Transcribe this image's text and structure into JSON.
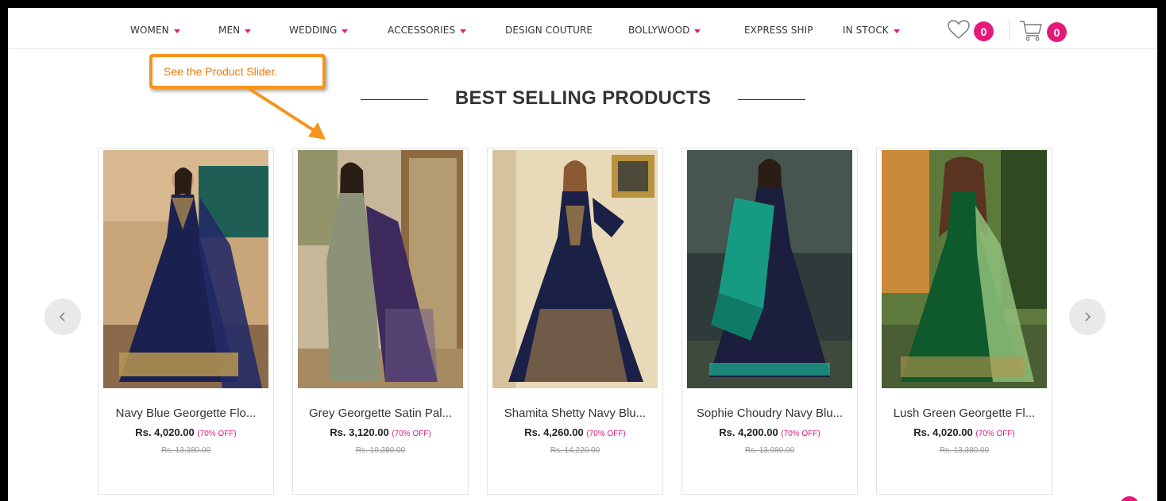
{
  "nav": {
    "items": [
      {
        "label": "WOMEN",
        "caret": true
      },
      {
        "label": "MEN",
        "caret": true
      },
      {
        "label": "WEDDING",
        "caret": true
      },
      {
        "label": "ACCESSORIES",
        "caret": true
      },
      {
        "label": "DESIGN COUTURE",
        "caret": false
      },
      {
        "label": "BOLLYWOOD",
        "caret": true
      },
      {
        "label": "EXPRESS SHIP",
        "caret": false
      },
      {
        "label": "IN STOCK",
        "caret": true
      }
    ],
    "wishlist_count": "0",
    "cart_count": "0"
  },
  "callout": {
    "text": "See the Product Slider."
  },
  "section": {
    "title": "BEST SELLING PRODUCTS"
  },
  "products": [
    {
      "name": "Navy Blue Georgette Flo...",
      "price": "Rs. 4,020.00",
      "discount": "(70% OFF)",
      "original_price": "Rs. 13,380.00"
    },
    {
      "name": "Grey Georgette Satin Pal...",
      "price": "Rs. 3,120.00",
      "discount": "(70% OFF)",
      "original_price": "Rs. 10,380.00"
    },
    {
      "name": "Shamita Shetty Navy Blu...",
      "price": "Rs. 4,260.00",
      "discount": "(70% OFF)",
      "original_price": "Rs. 14,220.00"
    },
    {
      "name": "Sophie Choudry Navy Blu...",
      "price": "Rs. 4,200.00",
      "discount": "(70% OFF)",
      "original_price": "Rs. 13,980.00"
    },
    {
      "name": "Lush Green Georgette Fl...",
      "price": "Rs. 4,020.00",
      "discount": "(70% OFF)",
      "original_price": "Rs. 13,380.00"
    }
  ],
  "controls": {
    "prev_icon": "chevron-left-icon",
    "next_icon": "chevron-right-icon"
  },
  "colors": {
    "accent": "#e5197a",
    "callout": "#f7941d"
  }
}
